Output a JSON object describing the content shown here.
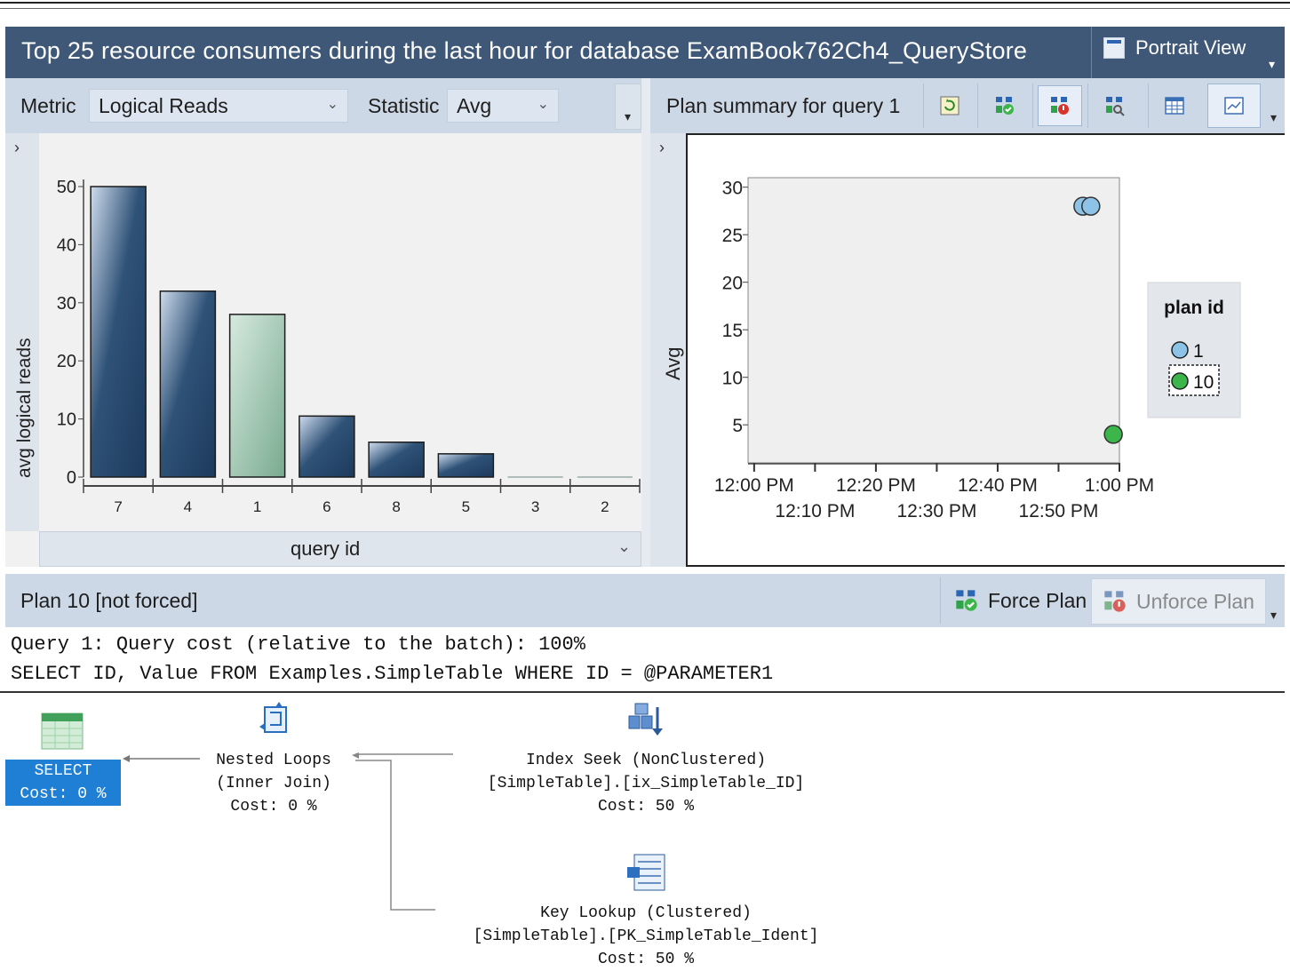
{
  "window": {
    "title": "Top 25 resource consumers during the last hour for database ExamBook762Ch4_QueryStore",
    "portrait_view": "Portrait View"
  },
  "left_toolbar": {
    "metric_label": "Metric",
    "metric_value": "Logical Reads",
    "statistic_label": "Statistic",
    "statistic_value": "Avg"
  },
  "right_toolbar": {
    "title": "Plan summary for query 1",
    "buttons": [
      "refresh-icon",
      "force-plan-icon",
      "unforce-plan-icon",
      "compare-plans-icon",
      "grid-view-icon",
      "chart-view-icon"
    ]
  },
  "chart_data": [
    {
      "type": "bar",
      "categories": [
        "7",
        "4",
        "1",
        "6",
        "8",
        "5",
        "3",
        "2"
      ],
      "values": [
        50,
        32,
        28,
        10.5,
        6,
        4,
        0,
        0
      ],
      "highlighted_category": "1",
      "ylabel": "avg logical reads",
      "xlabel": "query id",
      "ylim": [
        0,
        50
      ],
      "yticks": [
        0,
        10,
        20,
        30,
        40,
        50
      ],
      "colors": {
        "bar": "#2f5277",
        "highlight": "#79aa8f"
      }
    },
    {
      "type": "scatter",
      "ylabel": "Avg",
      "yticks": [
        5,
        10,
        15,
        20,
        25,
        30
      ],
      "ylim": [
        1,
        31
      ],
      "xticks_top": [
        "12:00 PM",
        "12:20 PM",
        "12:40 PM",
        "1:00 PM"
      ],
      "xticks_bottom": [
        "12:10 PM",
        "12:30 PM",
        "12:50 PM"
      ],
      "xtick_minutes": [
        0,
        10,
        20,
        30,
        40,
        50,
        60
      ],
      "xlim_minutes": [
        -1,
        60
      ],
      "series": [
        {
          "name": "1",
          "color": "#8ec3e8",
          "points": [
            {
              "x": 54,
              "y": 28
            },
            {
              "x": 55.3,
              "y": 28
            }
          ]
        },
        {
          "name": "10",
          "color": "#3cb54a",
          "points": [
            {
              "x": 59,
              "y": 4
            }
          ]
        }
      ],
      "legend": {
        "title": "plan id",
        "position": "right",
        "selected": "10"
      }
    }
  ],
  "query_bar": {
    "label": "query id"
  },
  "plan_bar": {
    "status": "Plan 10 [not forced]",
    "force_label": "Force Plan",
    "unforce_label": "Unforce Plan"
  },
  "sql": {
    "line1": "Query 1: Query cost (relative to the batch): 100%",
    "line2": "SELECT ID, Value FROM Examples.SimpleTable WHERE ID = @PARAMETER1"
  },
  "plan": {
    "select": {
      "name": "SELECT",
      "cost": "Cost: 0 %"
    },
    "nested": {
      "name": "Nested Loops",
      "sub": "(Inner Join)",
      "cost": "Cost: 0 %"
    },
    "seek": {
      "name": "Index Seek (NonClustered)",
      "sub": "[SimpleTable].[ix_SimpleTable_ID]",
      "cost": "Cost: 50 %"
    },
    "lookup": {
      "name": "Key Lookup (Clustered)",
      "sub": "[SimpleTable].[PK_SimpleTable_Ident]",
      "cost": "Cost: 50 %"
    }
  }
}
